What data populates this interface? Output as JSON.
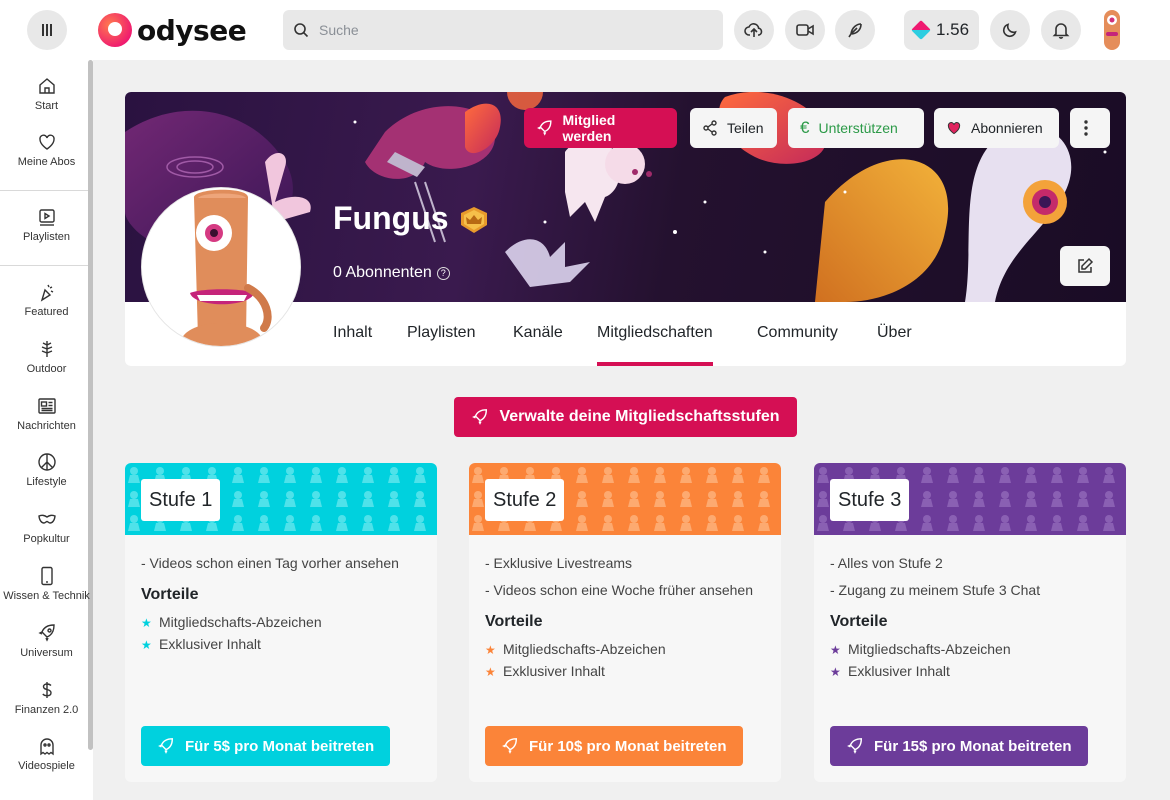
{
  "header": {
    "logo_text": "odysee",
    "search_placeholder": "Suche",
    "credits": "1.56"
  },
  "sidebar": {
    "items": [
      {
        "label": "Start",
        "icon": "home-icon"
      },
      {
        "label": "Meine Abos",
        "icon": "heart-icon"
      },
      {
        "label": "Playlisten",
        "icon": "playlist-icon"
      },
      {
        "label": "Featured",
        "icon": "featured-icon"
      },
      {
        "label": "Outdoor",
        "icon": "tree-icon"
      },
      {
        "label": "Nachrichten",
        "icon": "newspaper-icon"
      },
      {
        "label": "Lifestyle",
        "icon": "peace-icon"
      },
      {
        "label": "Popkultur",
        "icon": "mask-icon"
      },
      {
        "label": "Wissen & Technik",
        "icon": "phone-icon"
      },
      {
        "label": "Universum",
        "icon": "rocket-icon"
      },
      {
        "label": "Finanzen 2.0",
        "icon": "dollar-icon"
      },
      {
        "label": "Videospiele",
        "icon": "ghost-icon"
      }
    ]
  },
  "channel": {
    "name": "Fungus",
    "subscribers": "0 Abonnenten",
    "buttons": {
      "member": "Mitglied werden",
      "share": "Teilen",
      "support": "Unterstützen",
      "subscribe": "Abonnieren"
    },
    "tabs": [
      "Inhalt",
      "Playlisten",
      "Kanäle",
      "Mitgliedschaften",
      "Community",
      "Über"
    ],
    "active_tab": "Mitgliedschaften"
  },
  "memberships": {
    "manage_label": "Verwalte deine Mitgliedschaftsstufen",
    "benefits_heading": "Vorteile",
    "tiers": [
      {
        "title": "Stufe 1",
        "color": "#00d1de",
        "descriptions": [
          "- Videos schon einen Tag vorher ansehen"
        ],
        "perks": [
          "Mitgliedschafts-Abzeichen",
          "Exklusiver Inhalt"
        ],
        "join_label": "Für 5$ pro Monat beitreten"
      },
      {
        "title": "Stufe 2",
        "color": "#fb8439",
        "descriptions": [
          "- Exklusive Livestreams",
          "- Videos schon eine Woche früher ansehen"
        ],
        "perks": [
          "Mitgliedschafts-Abzeichen",
          "Exklusiver Inhalt"
        ],
        "join_label": "Für 10$ pro Monat beitreten"
      },
      {
        "title": "Stufe 3",
        "color": "#6c3c9a",
        "descriptions": [
          "- Alles von Stufe 2",
          "- Zugang zu meinem Stufe 3 Chat"
        ],
        "perks": [
          "Mitgliedschafts-Abzeichen",
          "Exklusiver Inhalt"
        ],
        "join_label": "Für 15$ pro Monat beitreten"
      }
    ]
  },
  "colors": {
    "accent": "#d50f54",
    "support_green": "#2c9a48"
  }
}
